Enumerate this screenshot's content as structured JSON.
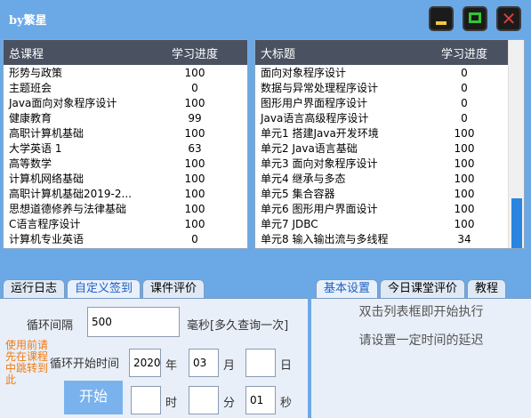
{
  "app": {
    "title": "by繁星",
    "buttons": {
      "minimize": "",
      "maximize": "",
      "close": "✕"
    }
  },
  "courses": {
    "headers": [
      "总课程",
      "学习进度"
    ],
    "rows": [
      [
        "形势与政策",
        "100"
      ],
      [
        "主题班会",
        "0"
      ],
      [
        "Java面向对象程序设计",
        "100"
      ],
      [
        "健康教育",
        "99"
      ],
      [
        "高职计算机基础",
        "100"
      ],
      [
        "大学英语 1",
        "63"
      ],
      [
        "高等数学",
        "100"
      ],
      [
        "计算机网络基础",
        "100"
      ],
      [
        "高职计算机基础2019-2...",
        "100"
      ],
      [
        "思想道德修养与法律基础",
        "100"
      ],
      [
        "C语言程序设计",
        "100"
      ],
      [
        "计算机专业英语",
        "0"
      ]
    ]
  },
  "chapters": {
    "headers": [
      "大标题",
      "学习进度"
    ],
    "rows": [
      [
        "面向对象程序设计",
        "0"
      ],
      [
        "数据与异常处理程序设计",
        "0"
      ],
      [
        "图形用户界面程序设计",
        "0"
      ],
      [
        "Java语言高级程序设计",
        "0"
      ],
      [
        "单元1 搭建Java开发环境",
        "100"
      ],
      [
        "单元2 Java语言基础",
        "100"
      ],
      [
        "单元3 面向对象程序设计",
        "100"
      ],
      [
        "单元4 继承与多态",
        "100"
      ],
      [
        "单元5 集合容器",
        "100"
      ],
      [
        "单元6 图形用户界面设计",
        "100"
      ],
      [
        "单元7 JDBC",
        "100"
      ],
      [
        "单元8 输入输出流与多线程",
        "34"
      ]
    ]
  },
  "tabs_left": [
    {
      "label": "运行日志",
      "active": false
    },
    {
      "label": "自定义签到",
      "active": true
    },
    {
      "label": "课件评价",
      "active": false
    }
  ],
  "tabs_right": [
    {
      "label": "基本设置",
      "active": true
    },
    {
      "label": "今日课堂评价",
      "active": false
    },
    {
      "label": "教程",
      "active": false
    }
  ],
  "signin": {
    "interval_label": "循环间隔",
    "interval_value": "500",
    "interval_unit": "毫秒[多久查询一次]",
    "start_time_label": "循环开始时间",
    "year_value": "2020",
    "year_label": "年",
    "month_value": "03",
    "month_label": "月",
    "day_value": "",
    "day_label": "日",
    "hour_value": "",
    "hour_label": "时",
    "minute_value": "",
    "minute_label": "分",
    "second_value": "01",
    "second_label": "秒",
    "side_note": "使用前请先在课程中跳转到此",
    "start_button": "开始"
  },
  "settings": {
    "line1": "双击列表框即开始执行",
    "line2": "请设置一定时间的延迟"
  },
  "colors": {
    "accent": "#6aa9e6",
    "header": "#4a5161",
    "note": "#f07b12",
    "active_tab": "#2060c0"
  }
}
